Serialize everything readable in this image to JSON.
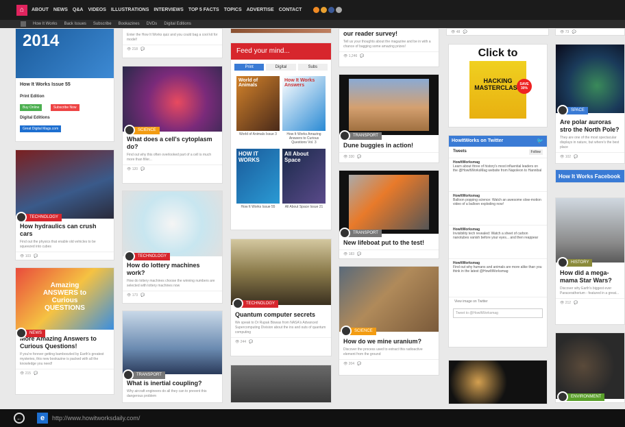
{
  "topnav": {
    "items": [
      "ABOUT",
      "NEWS",
      "Q&A",
      "VIDEOS",
      "ILLUSTRATIONS",
      "INTERVIEWS",
      "TOP 5 FACTS",
      "TOPICS",
      "ADVERTISE",
      "CONTACT"
    ]
  },
  "subnav": {
    "items": [
      "How It Works",
      "Back Issues",
      "Subscribe",
      "Bookazines",
      "DVDs",
      "Digital Editions"
    ]
  },
  "col1": {
    "issue_title": "How It Works Issue 55",
    "print_label": "Print Edition",
    "buy_online": "Buy Online",
    "subscribe_now": "Subscribe Now",
    "digital_label": "Digital Editions",
    "great_digital": "Great Digital Mags.com",
    "hydraulics": {
      "tag": "TECHNOLOGY",
      "title": "How hydraulics can crush cars",
      "desc": "Find out the physics that enable old vehicles to be squeezed into cubes"
    },
    "answers": {
      "tag": "NEWS",
      "title": "More Amazing Answers to Curious Questions!",
      "desc": "If you're forever getting bamboozled by Earth's greatest mysteries, this new bookazine is packed with all the knowledge you need!",
      "cover_text": "Amazing ANSWERS to Curious QUESTIONS"
    }
  },
  "col2": {
    "quiz_desc": "Enter the How It Works quiz and you could bag a cool kit for model!",
    "cytoplasm": {
      "tag": "SCIENCE",
      "title": "What does a cell's cytoplasm do?",
      "desc": "Find out why this often overlooked part of a cell is much more than filler..."
    },
    "lottery": {
      "tag": "TECHNOLOGY",
      "title": "How do lottery machines work?",
      "desc": "How do lottery machines choose the winning numbers are selected with lottery machines now"
    },
    "coupling": {
      "tag": "TRANSPORT",
      "title": "What is inertial coupling?",
      "desc": "Why aircraft engineers do all they can to prevent this dangerous problem"
    }
  },
  "col3": {
    "feed_title": "Feed your mind...",
    "tabs": [
      "Print",
      "Digital",
      "Subs"
    ],
    "mags": [
      {
        "label": "World of Animals Issue 3",
        "cover": "World of Animals"
      },
      {
        "label": "How It Works Amazing Answers to Curious Questions Vol. 3",
        "cover": "How It Works Answers"
      },
      {
        "label": "How It Works Issue 55",
        "cover": "HOW IT WORKS"
      },
      {
        "label": "All About Space Issue 21",
        "cover": "All About Space"
      }
    ],
    "quantum": {
      "tag": "TECHNOLOGY",
      "title": "Quantum computer secrets",
      "desc": "We speak to Dr Rupak Biswas from NASA's Advanced Supercomputing Division about the ins and outs of quantum computing"
    }
  },
  "col4": {
    "survey": {
      "title": "our reader survey!",
      "desc": "Tell us your thoughts about the magazine and be in with a chance of bagging some amazing prizes!"
    },
    "dune": {
      "tag": "TRANSPORT",
      "title": "Dune buggies in action!"
    },
    "lifeboat": {
      "tag": "TRANSPORT",
      "title": "New lifeboat put to the test!"
    },
    "uranium": {
      "tag": "SCIENCE",
      "title": "How do we mine uranium?",
      "desc": "Discover the process used to extract this radioactive element from the ground"
    }
  },
  "col5": {
    "click_to": "Click to",
    "hacking_title": "HACKING MASTERCLASS",
    "save_badge": "SAVE 30%",
    "twitter_title": "HowItWorks on Twitter",
    "tweets_label": "Tweets",
    "follow": "Follow",
    "tweets": [
      {
        "user": "HowItWorksmag",
        "handle": "@HowItWorksmag",
        "time": "5h",
        "text": "Learn about three of history's most influential leaders on the @HowItWorksMag website from Napoleon to Hannibal"
      },
      {
        "user": "HowItWorksmag",
        "handle": "@HowItWorksmag",
        "time": "7h",
        "text": "Balloon popping science: Watch an awesome slow-motion video of a balloon exploding now!"
      },
      {
        "user": "HowItWorksmag",
        "handle": "@HowItWorksmag",
        "time": "17h",
        "text": "Invisibility tech revealed: Watch a sheet of carbon nanotubes vanish before your eyes... and then reappear"
      },
      {
        "user": "HowItWorksmag",
        "handle": "@HowItWorksmag",
        "time": "20h",
        "text": "Find out why humans and animals are more alike than you think in the latest @HowItWorksmag"
      }
    ],
    "view_image": "View image on Twitter",
    "tweet_to": "Tweet to @HowItWorksmag"
  },
  "col6": {
    "auroras": {
      "tag": "SPACE",
      "title": "Are polar auroras stro the North Pole?",
      "desc": "They are one of the most spectacular displays in nature, but where's the best place"
    },
    "facebook": "How It Works Facebook",
    "mammal": {
      "tag": "HISTORY",
      "title": "How did a mega-mama Star Wars?",
      "desc": "Discover why Earth's biggest ever Paraceratherium - featured in a great..."
    },
    "env": {
      "tag": "ENVIRONMENT"
    }
  },
  "taskbar": {
    "url": "http://www.howitworksdaily.com/"
  }
}
